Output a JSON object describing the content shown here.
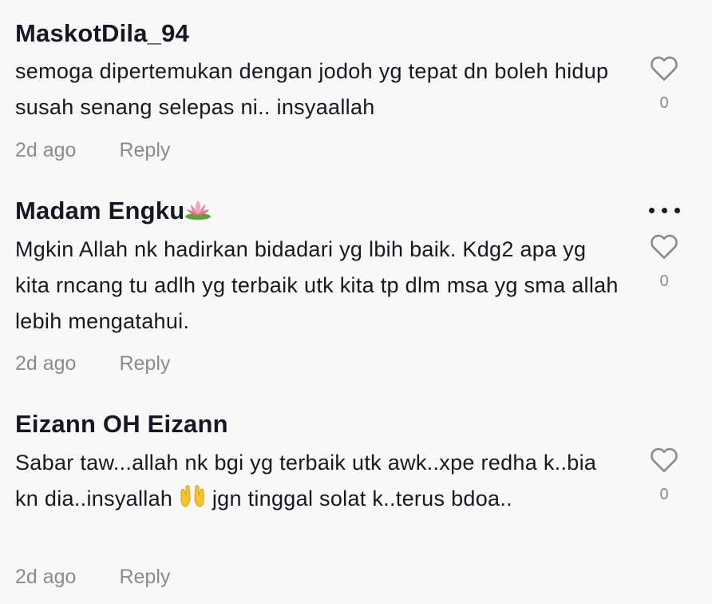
{
  "comments": [
    {
      "username": "MaskotDila_94",
      "username_emoji": "",
      "text": "semoga dipertemukan dengan jodoh yg tepat dn boleh hidup susah senang selepas ni.. insyaallah",
      "time": "2d ago",
      "reply_label": "Reply",
      "like_count": "0",
      "show_more": false
    },
    {
      "username": "Madam Engku",
      "username_emoji": "lotus-icon",
      "text": "Mgkin Allah nk hadirkan bidadari yg lbih baik. Kdg2 apa yg kita rncang tu adlh yg terbaik utk kita tp dlm msa yg sma allah lebih mengatahui.",
      "time": "2d ago",
      "reply_label": "Reply",
      "like_count": "0",
      "show_more": true
    },
    {
      "username": "Eizann OH Eizann",
      "username_emoji": "",
      "text_part1": "Sabar taw...allah nk bgi yg terbaik utk awk..xpe redha k..bia kn dia..insyallah",
      "text_emoji": "open-hands-icon",
      "text_part2": "jgn tinggal solat k..terus bdoa..",
      "time": "2d ago",
      "reply_label": "Reply",
      "like_count": "0",
      "show_more": false
    }
  ],
  "colors": {
    "background": "#f8f8f8",
    "primary_text": "#161823",
    "secondary_text": "#8a8b91",
    "heart_stroke": "#8a8b91"
  }
}
